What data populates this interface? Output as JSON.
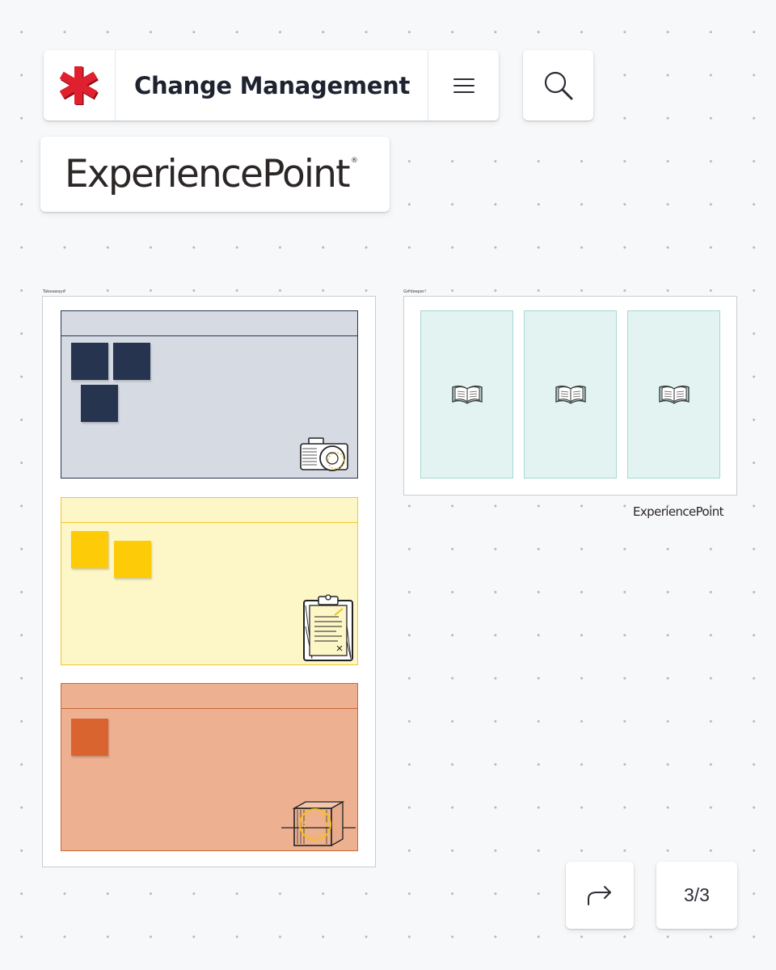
{
  "header": {
    "title": "Change Management",
    "logo_icon": "asterisk-logo-icon",
    "menu_icon": "hamburger-menu-icon",
    "search_icon": "search-icon"
  },
  "brand": {
    "name": "ExperiencePoint",
    "registered": "®"
  },
  "board": {
    "takeaways": {
      "label": "Takeaways",
      "panels": [
        {
          "name": "navy-panel",
          "fill": "#d5dae3",
          "border": "#2a3650",
          "sticky_color": "#27344f",
          "sticky_count": 3,
          "icon": "camera-icon"
        },
        {
          "name": "yellow-panel",
          "fill": "#fdf6c7",
          "border": "#f0c92e",
          "sticky_color": "#fdcb07",
          "sticky_count": 2,
          "icon": "clipboard-icon"
        },
        {
          "name": "orange-panel",
          "fill": "#edb091",
          "border": "#c9683a",
          "sticky_color": "#d96430",
          "sticky_count": 1,
          "icon": "cube-icon"
        }
      ]
    },
    "go_deeper": {
      "label": "Go deeper!",
      "cards": [
        {
          "icon": "open-book-icon"
        },
        {
          "icon": "open-book-icon"
        },
        {
          "icon": "open-book-icon"
        }
      ]
    },
    "footer_brand": "ExperiencePoint"
  },
  "footer": {
    "share_icon": "share-arrow-icon",
    "page_indicator": "3/3"
  },
  "colors": {
    "accent_red": "#e0202e",
    "resource_fill": "#e2f3f2",
    "canvas": "#f7f8fa"
  }
}
